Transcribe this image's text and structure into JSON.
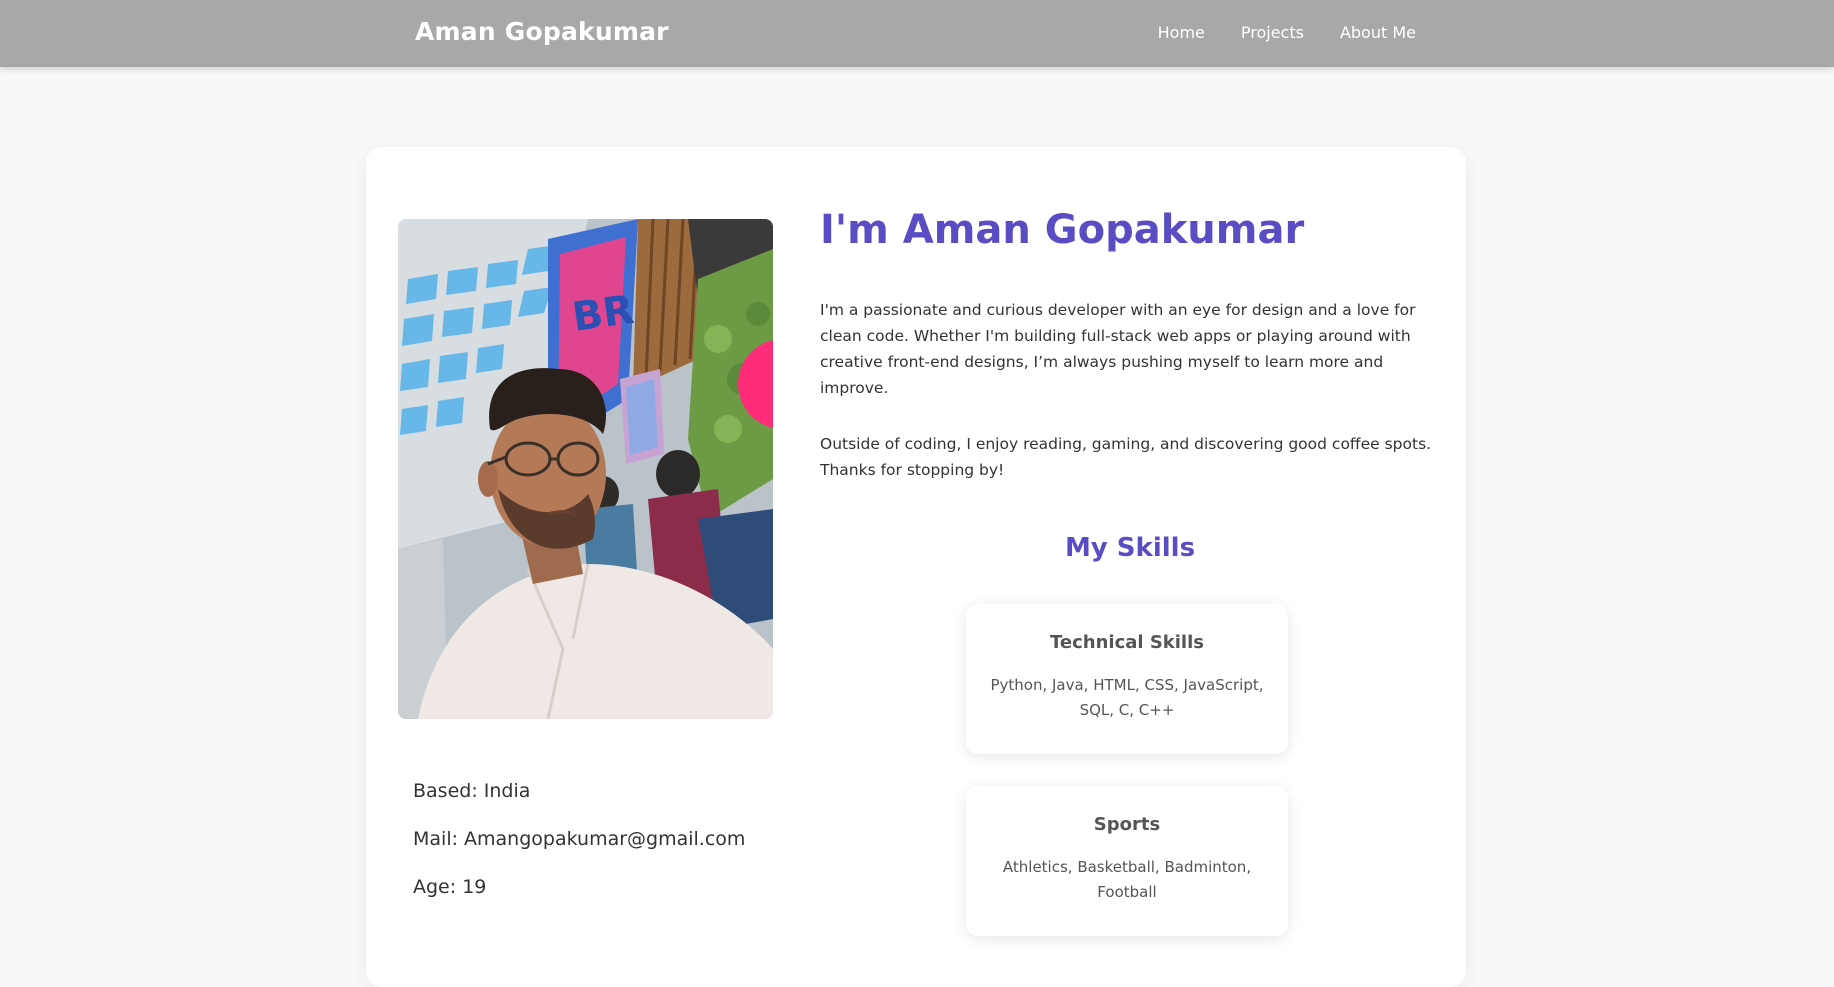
{
  "header": {
    "brand": "Aman Gopakumar",
    "nav": [
      {
        "label": "Home"
      },
      {
        "label": "Projects"
      },
      {
        "label": "About Me"
      }
    ]
  },
  "profile": {
    "photo_alt": "selfie-photo",
    "info": {
      "based": "Based: India",
      "mail": "Mail: Amangopakumar@gmail.com",
      "age": "Age: 19"
    }
  },
  "about": {
    "title": "I'm Aman Gopakumar",
    "paragraph_1": "I'm a passionate and curious developer with an eye for design and a love for clean code. Whether I'm building full-stack web apps or playing around with creative front-end designs, I’m always pushing myself to learn more and improve.",
    "paragraph_2": "Outside of coding, I enjoy reading, gaming, and discovering good coffee spots. Thanks for stopping by!"
  },
  "skills": {
    "heading": "My Skills",
    "cards": [
      {
        "title": "Technical Skills",
        "body": "Python, Java, HTML, CSS, JavaScript, SQL, C, C++"
      },
      {
        "title": "Sports",
        "body": "Athletics, Basketball, Badminton, Football"
      }
    ]
  },
  "colors": {
    "header_bg": "#a8a8a8",
    "accent": "#5a4dc4",
    "page_bg": "#f8f8f8",
    "card_bg": "#ffffff"
  }
}
